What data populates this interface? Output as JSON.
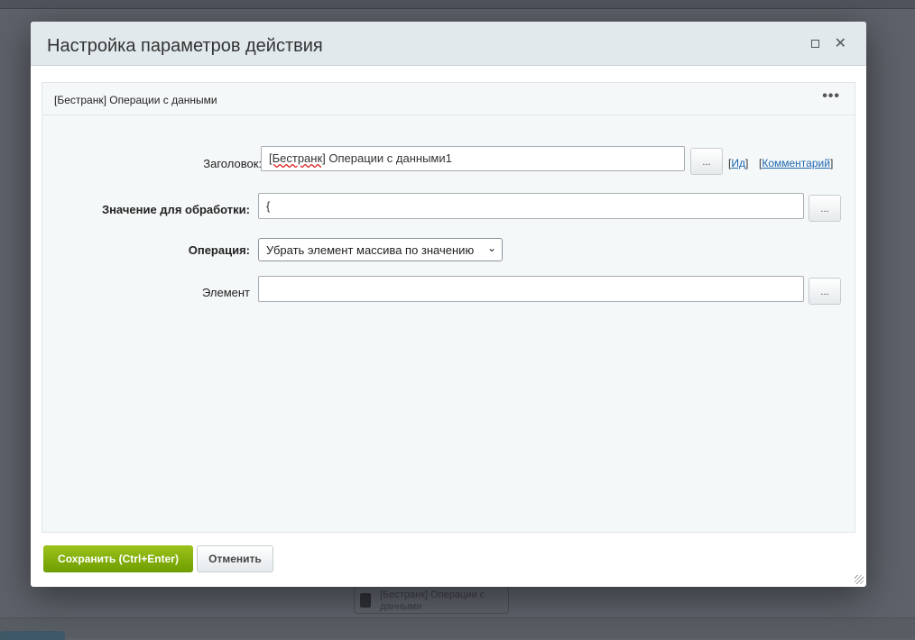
{
  "background": {
    "node_label": "[Бестранк] Операции с данными"
  },
  "dialog": {
    "title": "Настройка параметров действия"
  },
  "panel": {
    "title": "[Бестранк] Операции с данными",
    "menu_icon": "more-icon"
  },
  "form": {
    "title_label": "Заголовок:",
    "title_value_prefix": "[Бестранк]",
    "title_value_rest": " Операции с данными1",
    "more_button": "...",
    "id_link": "Ид",
    "comment_link": "Комментарий",
    "value_label": "Значение для обработки:",
    "value_text": "{",
    "operation_label": "Операция:",
    "operation_value": "Убрать элемент массива по значению",
    "element_label": "Элемент",
    "element_value": ""
  },
  "buttons": {
    "save": "Сохранить (Ctrl+Enter)",
    "cancel": "Отменить"
  }
}
